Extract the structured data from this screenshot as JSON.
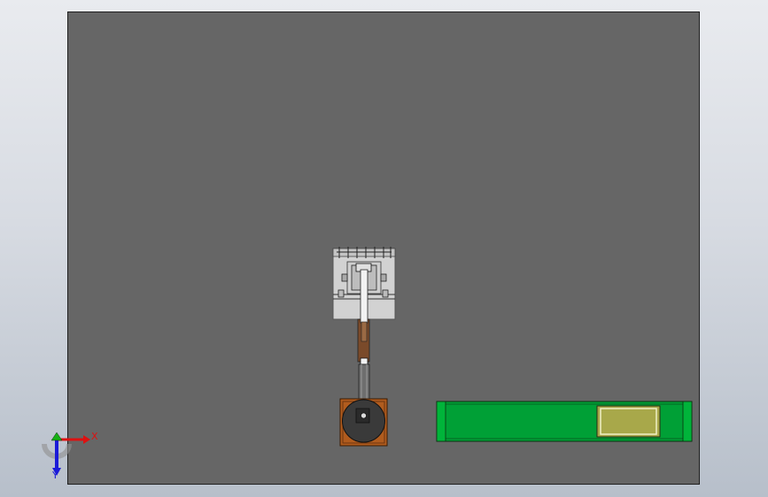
{
  "viewport": {
    "background_top": "#e9ebef",
    "background_bottom": "#b7bfca",
    "plate_color": "#666666"
  },
  "model": {
    "component_colors": {
      "frame": "#d2d2d2",
      "arm": "#eaeaea",
      "bracket": "#8b4a18",
      "base": "#b15c1e",
      "turntable": "#3a3a3a",
      "conveyor_belt": "#00a036",
      "conveyor_end": "#00b43a",
      "workpiece": "#a8a84a"
    }
  },
  "triad": {
    "x_label": "X",
    "y_label": "Y",
    "x_color": "#dd1111",
    "y_color": "#1b1bd8",
    "origin_color": "#16b016"
  }
}
